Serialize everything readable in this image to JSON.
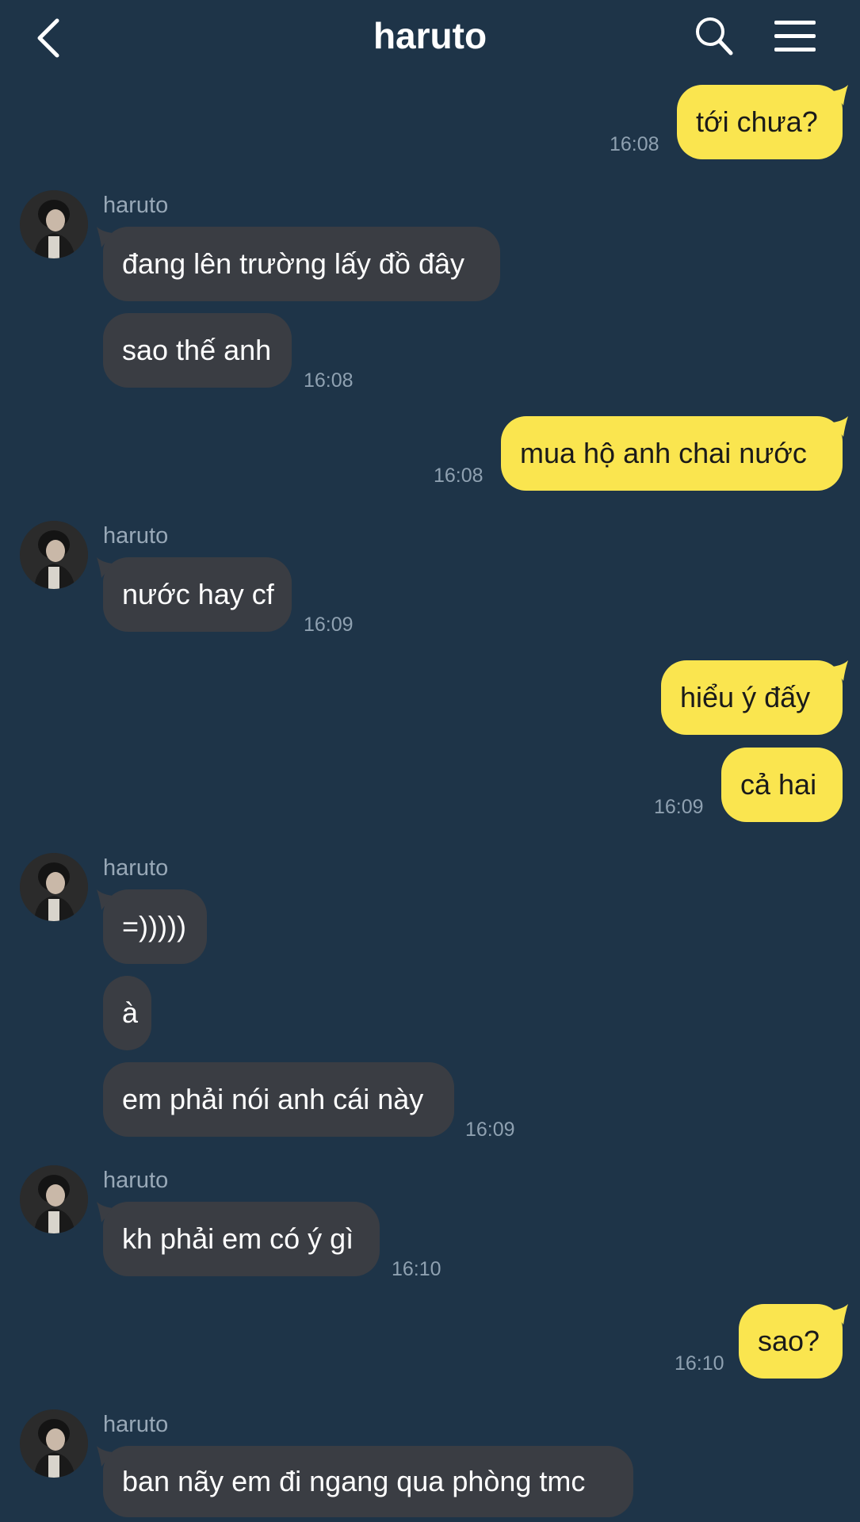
{
  "header": {
    "title": "haruto",
    "back_icon": "chevron-left-icon",
    "search_icon": "search-icon",
    "menu_icon": "hamburger-menu-icon"
  },
  "colors": {
    "background": "#1e3448",
    "incoming_bubble": "#3a3d43",
    "outgoing_bubble": "#fae54f",
    "timestamp": "#8fa1b1"
  },
  "messages": [
    {
      "dir": "out",
      "text": "tới chưa?",
      "time": "16:08"
    },
    {
      "dir": "in",
      "sender": "haruto",
      "text": "đang lên trường lấy đồ đây"
    },
    {
      "dir": "in",
      "text": "sao thế anh",
      "time": "16:08"
    },
    {
      "dir": "out",
      "text": "mua hộ anh chai nước",
      "time": "16:08"
    },
    {
      "dir": "in",
      "sender": "haruto",
      "text": "nước hay cf",
      "time": "16:09"
    },
    {
      "dir": "out",
      "text": "hiểu ý đấy"
    },
    {
      "dir": "out",
      "text": "cả hai",
      "time": "16:09"
    },
    {
      "dir": "in",
      "sender": "haruto",
      "text": "=)))))"
    },
    {
      "dir": "in",
      "text": "à"
    },
    {
      "dir": "in",
      "text": "em phải nói anh cái này",
      "time": "16:09"
    },
    {
      "dir": "in",
      "sender": "haruto",
      "text": "kh phải em có ý gì",
      "time": "16:10"
    },
    {
      "dir": "out",
      "text": "sao?",
      "time": "16:10"
    },
    {
      "dir": "in",
      "sender": "haruto",
      "text": "ban nãy em đi ngang qua phòng tmc"
    }
  ]
}
